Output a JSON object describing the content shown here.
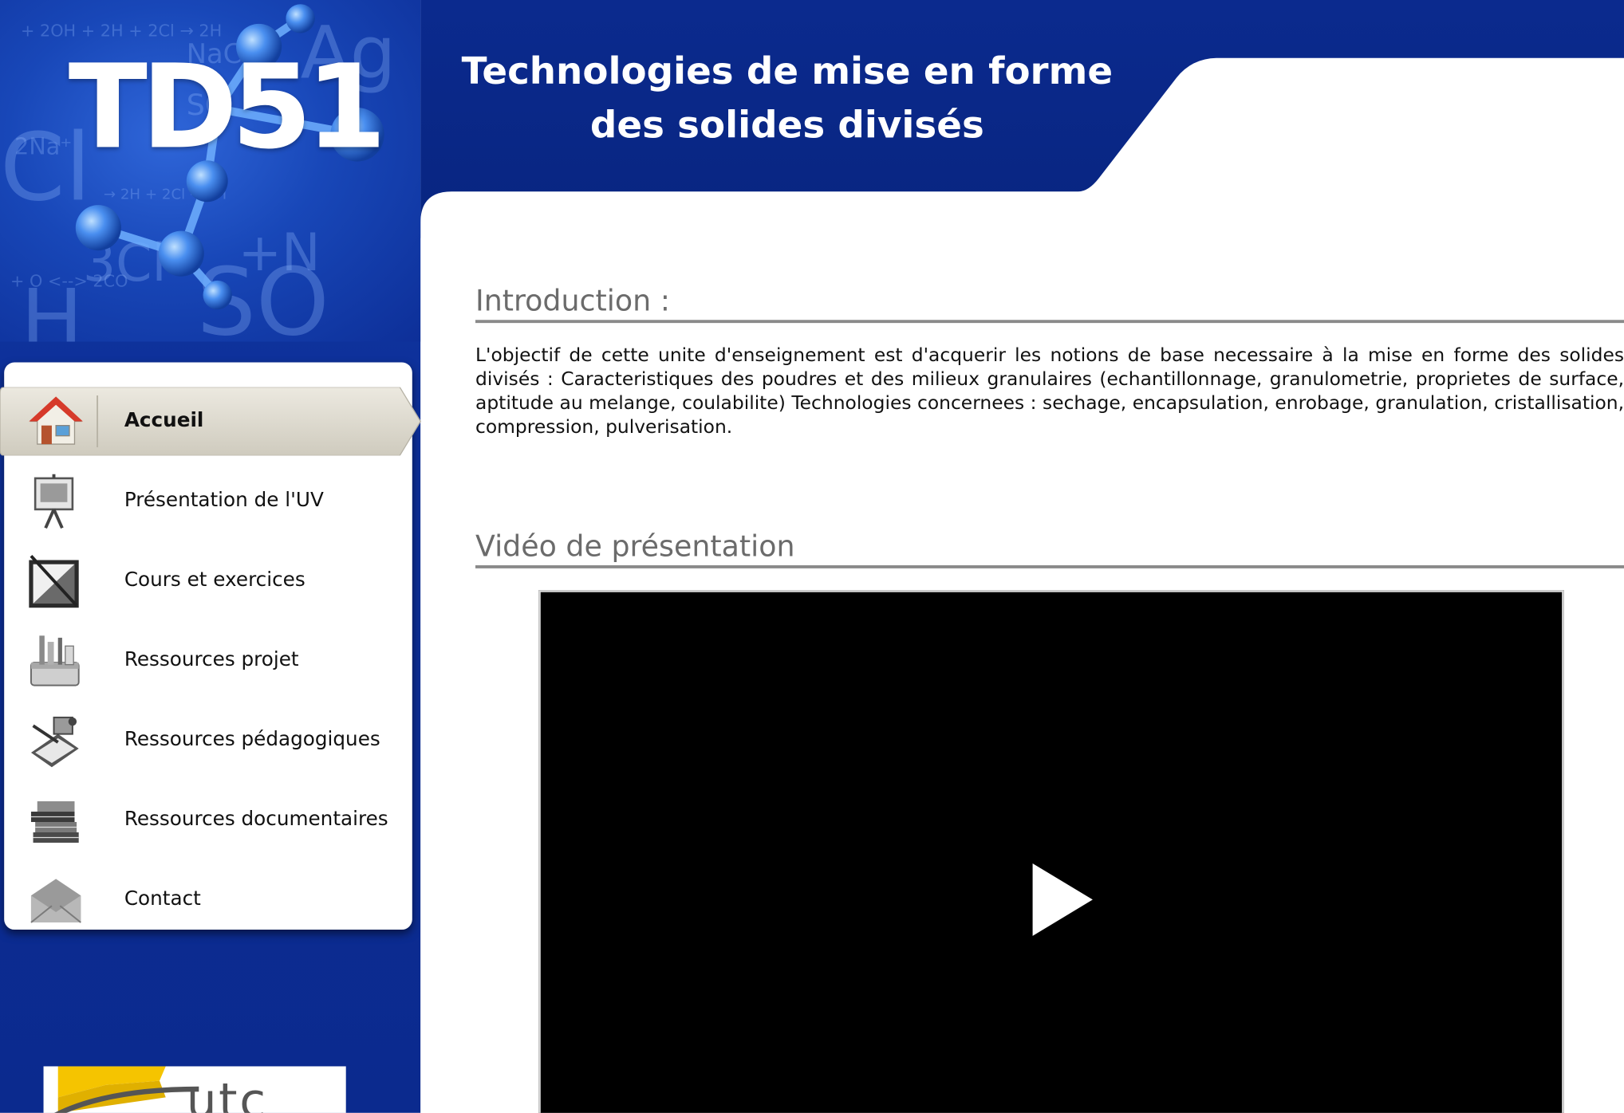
{
  "site": {
    "logo_text": "TD51",
    "title_line1": "Technologies de mise en forme",
    "title_line2": "des solides divisés"
  },
  "nav": {
    "items": [
      {
        "label": "Accueil",
        "icon": "home-icon",
        "active": true
      },
      {
        "label": "Présentation de l'UV",
        "icon": "presentation-board-icon",
        "active": false
      },
      {
        "label": "Cours et exercices",
        "icon": "drafting-tools-icon",
        "active": false
      },
      {
        "label": "Ressources projet",
        "icon": "toolbox-icon",
        "active": false
      },
      {
        "label": "Ressources pédagogiques",
        "icon": "education-tools-icon",
        "active": false
      },
      {
        "label": "Ressources documentaires",
        "icon": "books-icon",
        "active": false
      },
      {
        "label": "Contact",
        "icon": "envelope-icon",
        "active": false
      }
    ]
  },
  "main": {
    "intro_heading": "Introduction :",
    "intro_text": "L'objectif de cette unite d'enseignement est d'acquerir les notions de base necessaire à la mise en forme des solides divisés : Caracteristiques des poudres et des milieux granulaires (echantillonnage, granulometrie, proprietes de surface, aptitude au melange, coulabilite) Technologies concernees : sechage, encapsulation, enrobage, granulation, cristallisation, compression, pulverisation.",
    "video_heading": "Vidéo de présentation"
  },
  "footer": {
    "utc_logo_text": "utc"
  },
  "colors": {
    "header_blue": "#0b2a8e",
    "nav_active_bg": "#d9d6cc",
    "heading_gray": "#6b6b6b"
  }
}
